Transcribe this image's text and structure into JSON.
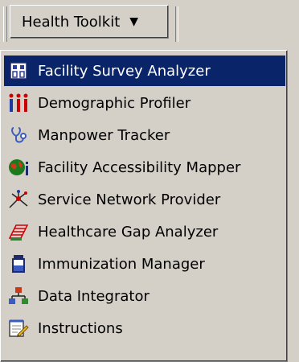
{
  "toolbar": {
    "menu_button_label": "Health Toolkit",
    "caret": "▼"
  },
  "menu": {
    "items": [
      {
        "label": "Facility Survey Analyzer",
        "icon": "survey-grid-icon",
        "selected": true
      },
      {
        "label": "Demographic Profiler",
        "icon": "people-icon",
        "selected": false
      },
      {
        "label": "Manpower Tracker",
        "icon": "stethoscope-icon",
        "selected": false
      },
      {
        "label": "Facility Accessibility Mapper",
        "icon": "globe-pin-icon",
        "selected": false
      },
      {
        "label": "Service Network Provider",
        "icon": "network-icon",
        "selected": false
      },
      {
        "label": "Healthcare Gap Analyzer",
        "icon": "gap-chart-icon",
        "selected": false
      },
      {
        "label": "Immunization Manager",
        "icon": "vial-icon",
        "selected": false
      },
      {
        "label": "Data Integrator",
        "icon": "hierarchy-icon",
        "selected": false
      },
      {
        "label": "Instructions",
        "icon": "notepad-pencil-icon",
        "selected": false
      }
    ]
  },
  "colors": {
    "face": "#d4d0c8",
    "highlight": "#0a246a",
    "highlight_text": "#ffffff"
  }
}
